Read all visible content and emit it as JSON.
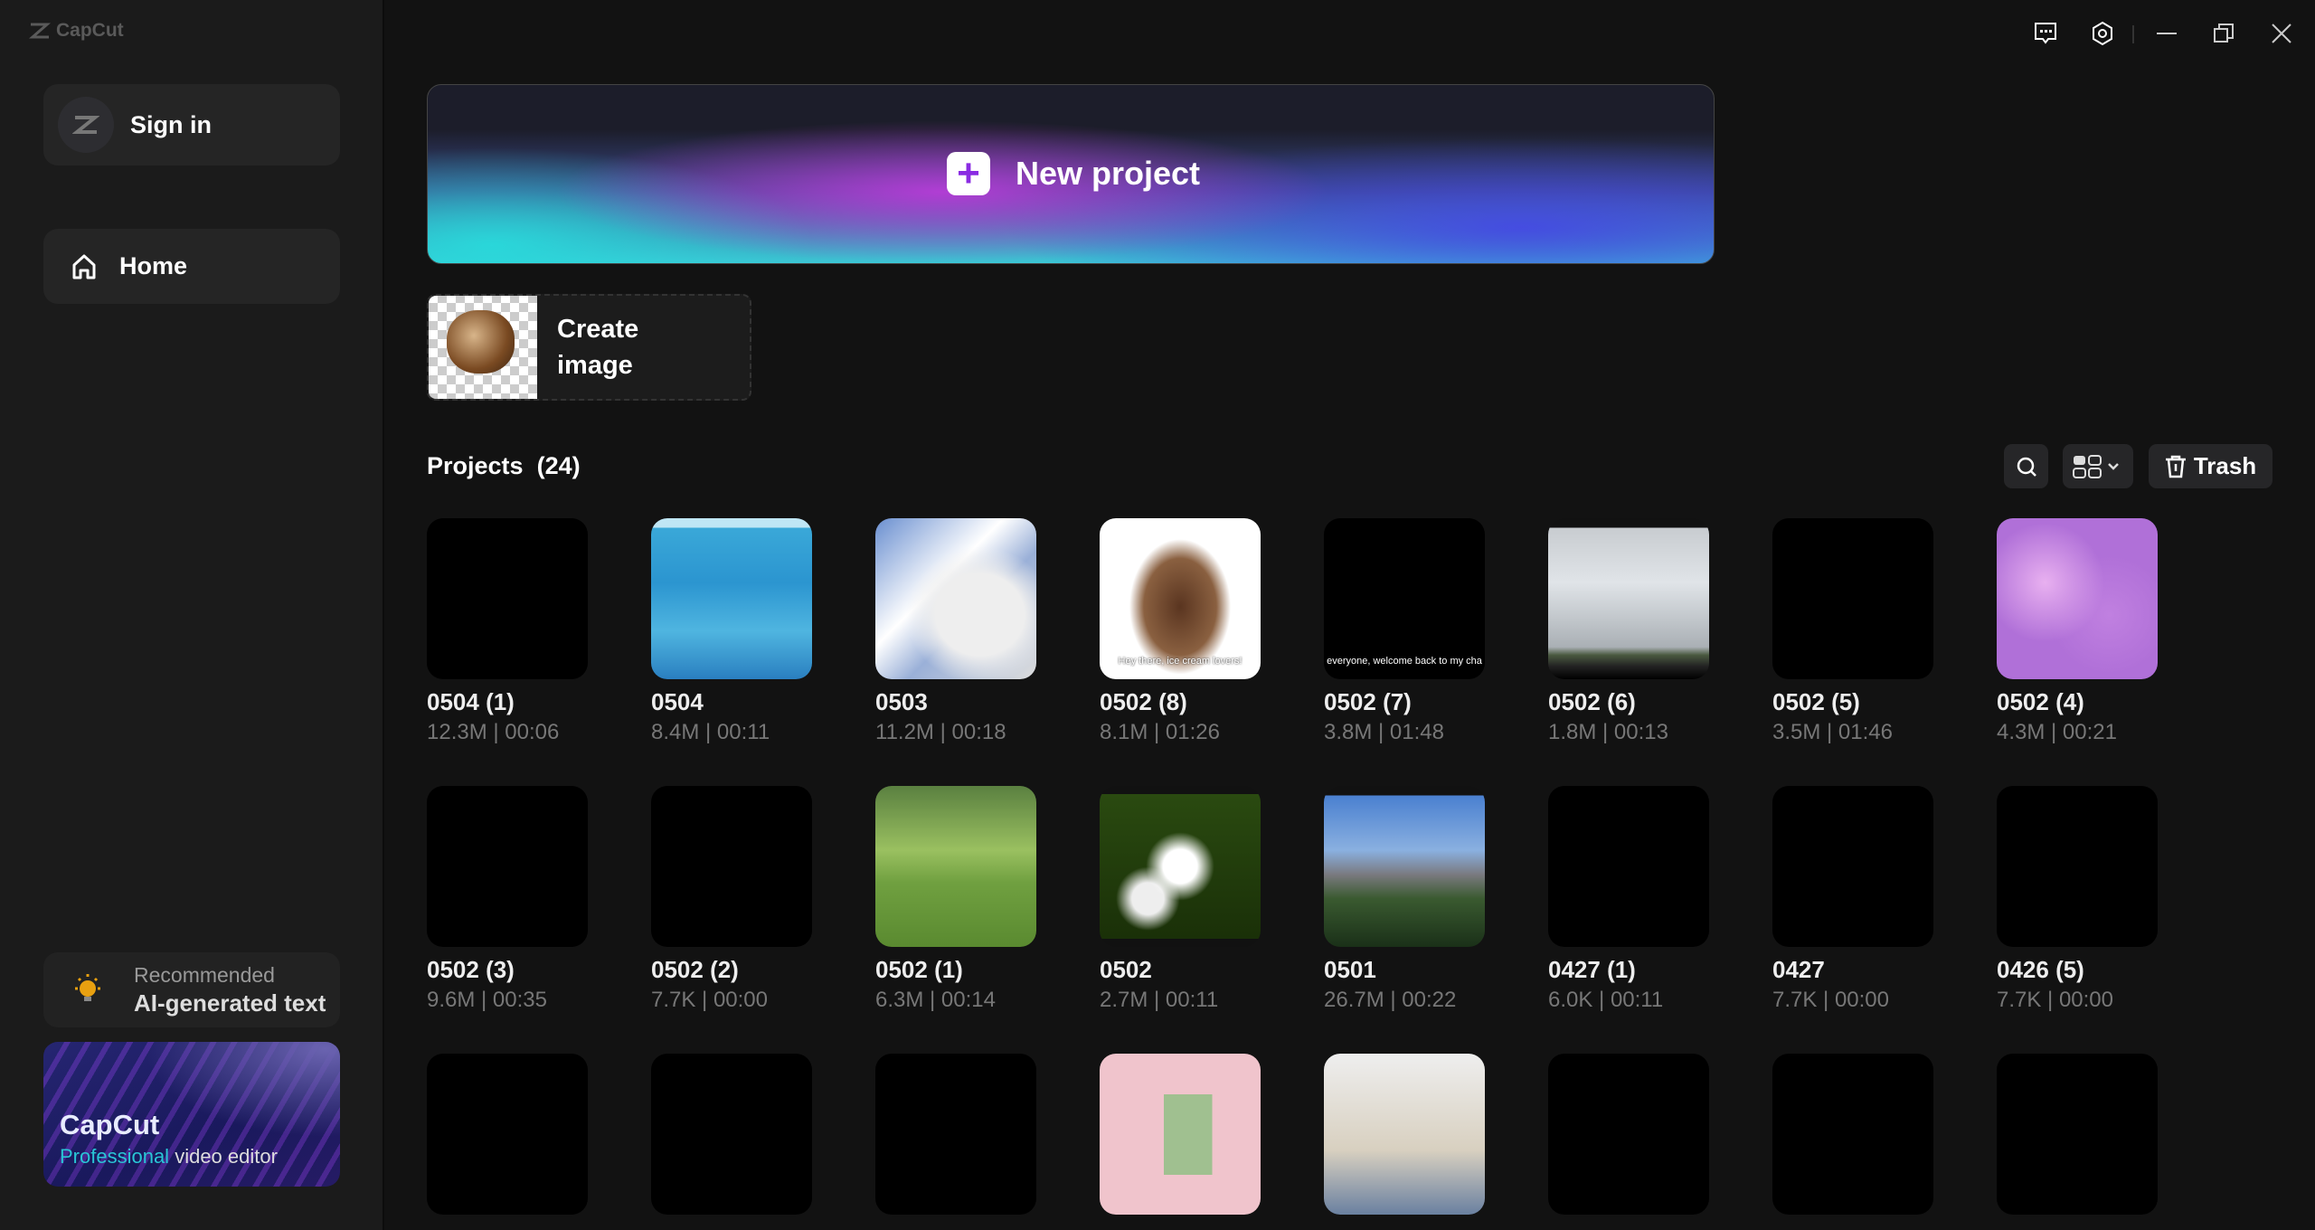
{
  "app": {
    "name": "CapCut"
  },
  "sidebar": {
    "sign_in": "Sign in",
    "home": "Home",
    "recommended_label": "Recommended",
    "recommended_title": "AI-generated text",
    "promo_title": "CapCut",
    "promo_sub_highlight": "Professional",
    "promo_sub_rest": " video editor"
  },
  "main": {
    "new_project": "New project",
    "create_image": "Create image",
    "projects_label": "Projects",
    "projects_count": "(24)",
    "trash": "Trash"
  },
  "projects": [
    {
      "name": "0504 (1)",
      "meta": "12.3M | 00:06",
      "thumb": "black"
    },
    {
      "name": "0504",
      "meta": "8.4M | 00:11",
      "thumb": "sea"
    },
    {
      "name": "0503",
      "meta": "11.2M | 00:18",
      "thumb": "tree"
    },
    {
      "name": "0502 (8)",
      "meta": "8.1M | 01:26",
      "thumb": "icecream",
      "caption": "Hey there, ice cream lovers!"
    },
    {
      "name": "0502 (7)",
      "meta": "3.8M | 01:48",
      "thumb": "black",
      "caption": "everyone, welcome back to my cha"
    },
    {
      "name": "0502 (6)",
      "meta": "1.8M | 00:13",
      "thumb": "sky"
    },
    {
      "name": "0502 (5)",
      "meta": "3.5M | 01:46",
      "thumb": "black"
    },
    {
      "name": "0502 (4)",
      "meta": "4.3M | 00:21",
      "thumb": "flowers"
    },
    {
      "name": "0502 (3)",
      "meta": "9.6M | 00:35",
      "thumb": "black"
    },
    {
      "name": "0502 (2)",
      "meta": "7.7K | 00:00",
      "thumb": "black"
    },
    {
      "name": "0502 (1)",
      "meta": "6.3M | 00:14",
      "thumb": "park"
    },
    {
      "name": "0502",
      "meta": "2.7M | 00:11",
      "thumb": "blossom"
    },
    {
      "name": "0501",
      "meta": "26.7M | 00:22",
      "thumb": "city"
    },
    {
      "name": "0427 (1)",
      "meta": "6.0K | 00:11",
      "thumb": "black"
    },
    {
      "name": "0427",
      "meta": "7.7K | 00:00",
      "thumb": "black"
    },
    {
      "name": "0426 (5)",
      "meta": "7.7K | 00:00",
      "thumb": "black"
    },
    {
      "name": "",
      "meta": "",
      "thumb": "black"
    },
    {
      "name": "",
      "meta": "",
      "thumb": "black"
    },
    {
      "name": "",
      "meta": "",
      "thumb": "black"
    },
    {
      "name": "",
      "meta": "",
      "thumb": "bunny"
    },
    {
      "name": "",
      "meta": "",
      "thumb": "christmas"
    },
    {
      "name": "",
      "meta": "",
      "thumb": "black"
    },
    {
      "name": "",
      "meta": "",
      "thumb": "black"
    },
    {
      "name": "",
      "meta": "",
      "thumb": "black"
    }
  ]
}
